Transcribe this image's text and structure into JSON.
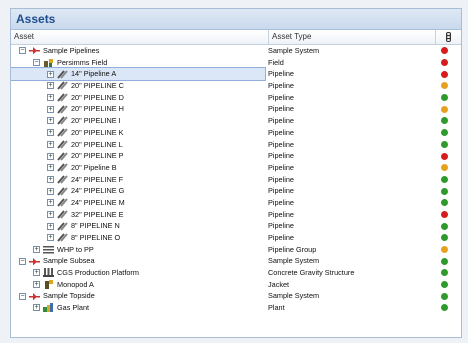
{
  "panel": {
    "title": "Assets"
  },
  "columns": {
    "asset": "Asset",
    "type": "Asset Type"
  },
  "colors": {
    "red": "#d51d1d",
    "green": "#2e9a2e",
    "orange": "#e8a11f"
  },
  "rows": [
    {
      "level": 0,
      "expander": "−",
      "icon": "system-icon",
      "name": "Sample Pipelines",
      "type": "Sample System",
      "status": "red"
    },
    {
      "level": 1,
      "expander": "−",
      "icon": "field-icon",
      "name": "Persimms Field",
      "type": "Field",
      "status": "red"
    },
    {
      "level": 2,
      "expander": "+",
      "icon": "pipeline-icon",
      "name": "14\" Pipeline A",
      "type": "Pipeline",
      "status": "red",
      "selected": true
    },
    {
      "level": 2,
      "expander": "+",
      "icon": "pipeline-icon",
      "name": "20\" PIPELINE C",
      "type": "Pipeline",
      "status": "orange"
    },
    {
      "level": 2,
      "expander": "+",
      "icon": "pipeline-icon",
      "name": "20\" PIPELINE D",
      "type": "Pipeline",
      "status": "green"
    },
    {
      "level": 2,
      "expander": "+",
      "icon": "pipeline-icon",
      "name": "20\" PIPELINE H",
      "type": "Pipeline",
      "status": "orange"
    },
    {
      "level": 2,
      "expander": "+",
      "icon": "pipeline-icon",
      "name": "20\" PIPELINE I",
      "type": "Pipeline",
      "status": "green"
    },
    {
      "level": 2,
      "expander": "+",
      "icon": "pipeline-icon",
      "name": "20\" PIPELINE K",
      "type": "Pipeline",
      "status": "green"
    },
    {
      "level": 2,
      "expander": "+",
      "icon": "pipeline-icon",
      "name": "20\" PIPELINE L",
      "type": "Pipeline",
      "status": "green"
    },
    {
      "level": 2,
      "expander": "+",
      "icon": "pipeline-icon",
      "name": "20\" PIPELINE P",
      "type": "Pipeline",
      "status": "red"
    },
    {
      "level": 2,
      "expander": "+",
      "icon": "pipeline-icon",
      "name": "20\" Pipeline B",
      "type": "Pipeline",
      "status": "orange"
    },
    {
      "level": 2,
      "expander": "+",
      "icon": "pipeline-icon",
      "name": "24\" PIPELINE F",
      "type": "Pipeline",
      "status": "green"
    },
    {
      "level": 2,
      "expander": "+",
      "icon": "pipeline-icon",
      "name": "24\" PIPELINE G",
      "type": "Pipeline",
      "status": "green"
    },
    {
      "level": 2,
      "expander": "+",
      "icon": "pipeline-icon",
      "name": "24\" PIPELINE M",
      "type": "Pipeline",
      "status": "green"
    },
    {
      "level": 2,
      "expander": "+",
      "icon": "pipeline-icon",
      "name": "32\" PIPELINE E",
      "type": "Pipeline",
      "status": "red"
    },
    {
      "level": 2,
      "expander": "+",
      "icon": "pipeline-icon",
      "name": "8\" PIPELINE N",
      "type": "Pipeline",
      "status": "green"
    },
    {
      "level": 2,
      "expander": "+",
      "icon": "pipeline-icon",
      "name": "8\" PIPELINE O",
      "type": "Pipeline",
      "status": "green"
    },
    {
      "level": 1,
      "expander": "+",
      "icon": "pipeline-group-icon",
      "name": "WHP to PP",
      "type": "Pipeline Group",
      "status": "orange"
    },
    {
      "level": 0,
      "expander": "−",
      "icon": "system-icon",
      "name": "Sample Subsea",
      "type": "Sample System",
      "status": "green"
    },
    {
      "level": 1,
      "expander": "+",
      "icon": "gravity-structure-icon",
      "name": "CGS Production Platform",
      "type": "Concrete Gravity Structure",
      "status": "green"
    },
    {
      "level": 1,
      "expander": "+",
      "icon": "jacket-icon",
      "name": "Monopod A",
      "type": "Jacket",
      "status": "green"
    },
    {
      "level": 0,
      "expander": "−",
      "icon": "system-icon",
      "name": "Sample Topside",
      "type": "Sample System",
      "status": "green"
    },
    {
      "level": 1,
      "expander": "+",
      "icon": "plant-icon",
      "name": "Gas Plant",
      "type": "Plant",
      "status": "green"
    }
  ]
}
